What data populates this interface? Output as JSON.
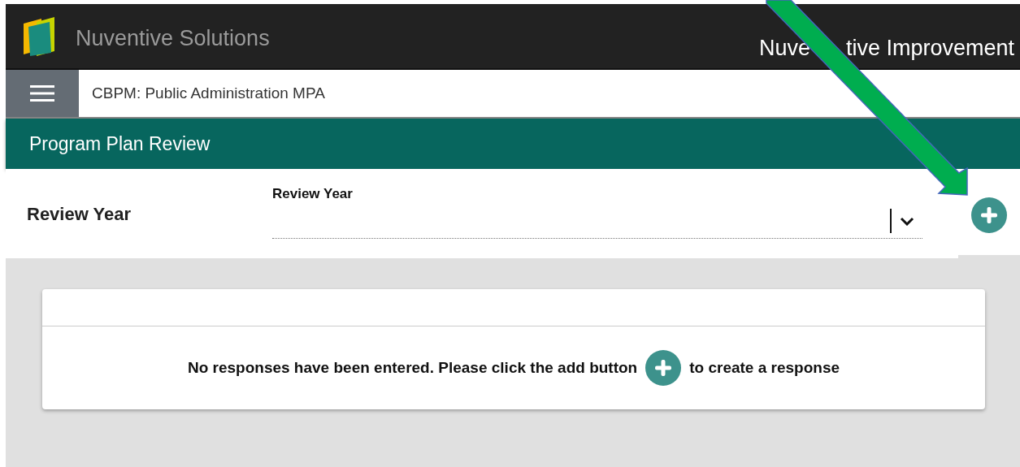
{
  "header": {
    "brand": "Nuventive Solutions",
    "product_parts": [
      "Nuve",
      "tive Improvement"
    ]
  },
  "breadcrumb": {
    "title": "CBPM: Public Administration MPA"
  },
  "page_title": "Program Plan Review",
  "section": {
    "heading": "Review Year",
    "field": {
      "label": "Review Year"
    }
  },
  "empty_state": {
    "before": "No responses have been entered. Please click the add button",
    "after": "to create a response"
  }
}
